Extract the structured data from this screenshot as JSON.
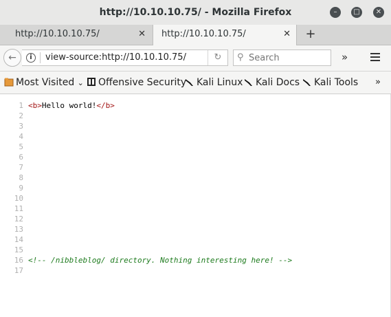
{
  "window": {
    "title": "http://10.10.10.75/ - Mozilla Firefox"
  },
  "tabs": [
    {
      "label": "http://10.10.10.75/",
      "active": false
    },
    {
      "label": "http://10.10.10.75/",
      "active": true
    }
  ],
  "toolbar": {
    "url": "view-source:http://10.10.10.75/",
    "search_placeholder": "Search"
  },
  "bookmarks": [
    {
      "label": "Most Visited",
      "icon": "folder-icon"
    },
    {
      "label": "Offensive Security",
      "icon": "offsec-icon"
    },
    {
      "label": "Kali Linux",
      "icon": "kali-dragon-icon"
    },
    {
      "label": "Kali Docs",
      "icon": "kali-dragon-icon"
    },
    {
      "label": "Kali Tools",
      "icon": "kali-dragon-icon"
    }
  ],
  "source": {
    "line1": {
      "num": "1",
      "open_tag": "<b>",
      "text": "Hello world!",
      "close_tag": "</b>"
    },
    "empty_lines": [
      "2",
      "3",
      "4",
      "5",
      "6",
      "7",
      "8",
      "9",
      "10",
      "11",
      "12",
      "13",
      "14",
      "15"
    ],
    "line16": {
      "num": "16",
      "comment": "<!-- /nibbleblog/ directory. Nothing interesting here! -->"
    },
    "line17": {
      "num": "17"
    }
  },
  "colors": {
    "tag": "#a31515",
    "comment": "#1c7a1c",
    "line_number": "#b0b0b0"
  }
}
